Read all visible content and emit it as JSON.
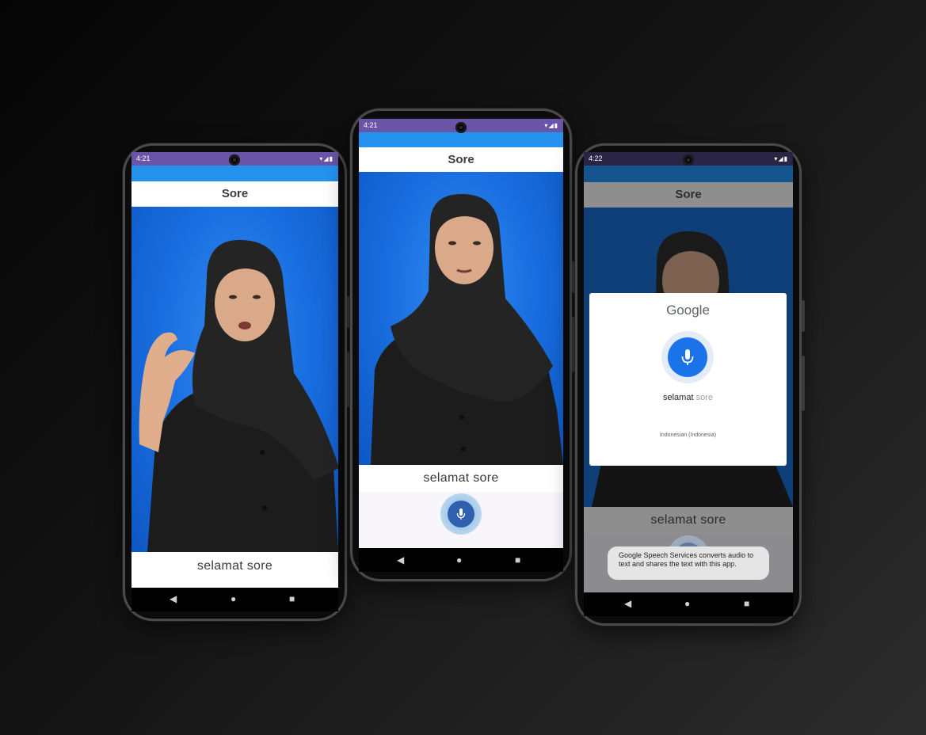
{
  "phones": [
    {
      "status_time": "4:21",
      "title": "Sore",
      "caption": "selamat sore"
    },
    {
      "status_time": "4:21",
      "title": "Sore",
      "caption": "selamat sore"
    },
    {
      "status_time": "4:22",
      "title": "Sore",
      "caption": "selamat sore",
      "dialog": {
        "brand": "Google",
        "transcript_final": "selamat",
        "transcript_partial": "sore",
        "language": "Indonesian (Indonesia)"
      },
      "toast": "Google Speech Services converts audio to text and shares the text with this app."
    }
  ],
  "icons": {
    "status": "wifi-signal-battery-icons",
    "nav_back": "back-triangle-icon",
    "nav_home": "home-circle-icon",
    "nav_recents": "recents-square-icon",
    "mic": "microphone-icon"
  },
  "colors": {
    "status_bar": "#6a54a8",
    "video_bg": "#1a6ee0",
    "mic_button": "#2f5fae",
    "google_mic": "#1a73e8"
  }
}
